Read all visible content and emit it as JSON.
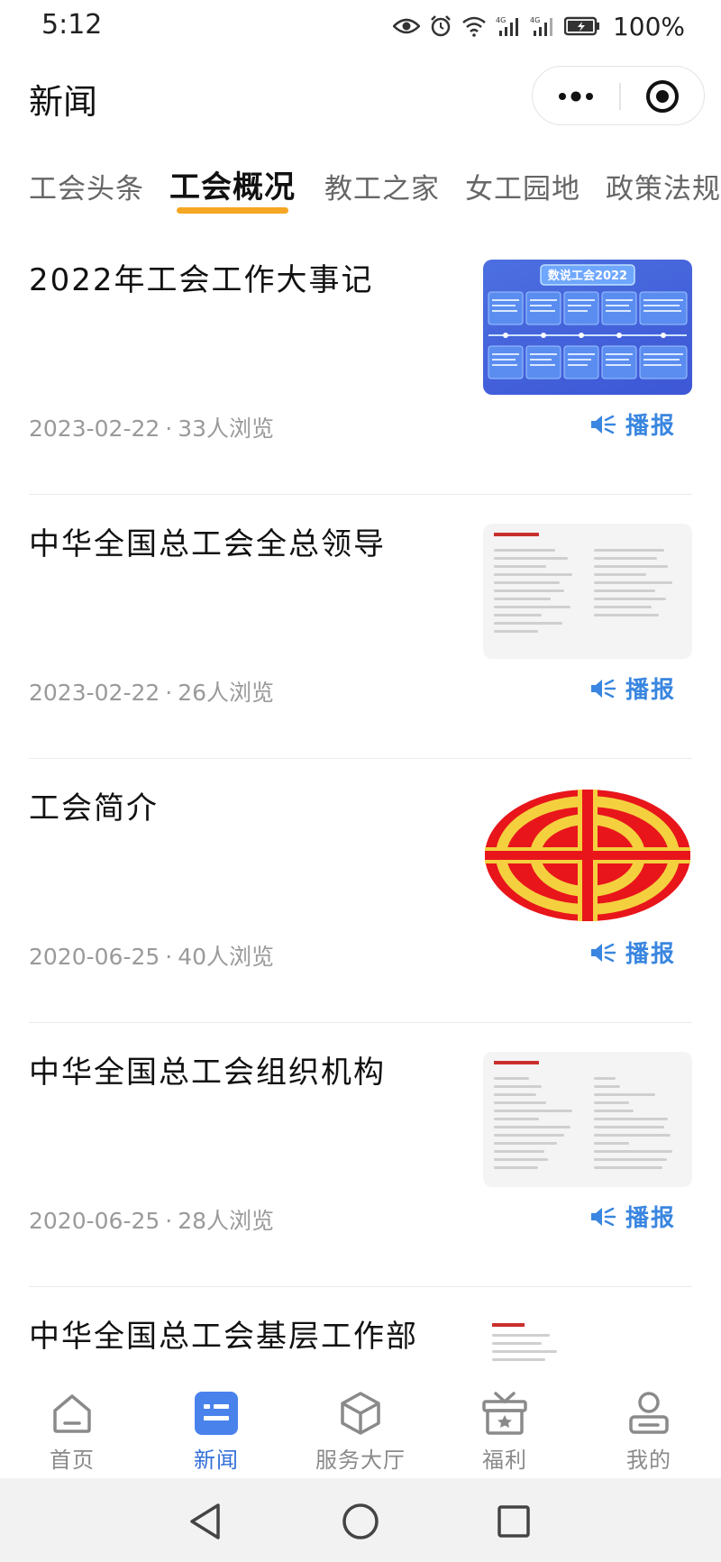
{
  "status_bar": {
    "time": "5:12",
    "battery": "100%"
  },
  "header": {
    "title": "新闻"
  },
  "tabs": [
    {
      "label": "工会头条",
      "active": false
    },
    {
      "label": "工会概况",
      "active": true
    },
    {
      "label": "教工之家",
      "active": false
    },
    {
      "label": "女工园地",
      "active": false
    },
    {
      "label": "政策法规",
      "active": false
    }
  ],
  "news": [
    {
      "title": "2022年工会工作大事记",
      "date": "2023-02-22",
      "views": "33人浏览",
      "broadcast_label": "播报"
    },
    {
      "title": "中华全国总工会全总领导",
      "date": "2023-02-22",
      "views": "26人浏览",
      "broadcast_label": "播报"
    },
    {
      "title": "工会简介",
      "date": "2020-06-25",
      "views": "40人浏览",
      "broadcast_label": "播报"
    },
    {
      "title": "中华全国总工会组织机构",
      "date": "2020-06-25",
      "views": "28人浏览",
      "broadcast_label": "播报"
    },
    {
      "title": "中华全国总工会基层工作部",
      "date": "",
      "views": "",
      "broadcast_label": ""
    }
  ],
  "thumb_texts": {
    "banner_title": "数说工会2022"
  },
  "bottom_nav": [
    {
      "label": "首页",
      "icon": "home-icon",
      "active": false
    },
    {
      "label": "新闻",
      "icon": "news-icon",
      "active": true
    },
    {
      "label": "服务大厅",
      "icon": "cube-icon",
      "active": false
    },
    {
      "label": "福利",
      "icon": "gift-icon",
      "active": false
    },
    {
      "label": "我的",
      "icon": "user-icon",
      "active": false
    }
  ],
  "colors": {
    "accent": "#3470d8",
    "tab_underline": "#f5a623",
    "broadcast": "#3a86e0"
  }
}
